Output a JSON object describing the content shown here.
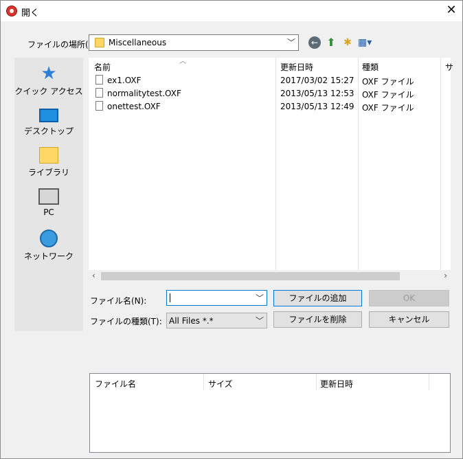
{
  "window": {
    "title": "開く",
    "close_symbol": "✕"
  },
  "lookin": {
    "label": "ファイルの場所(I):",
    "value": "Miscellaneous"
  },
  "places": [
    {
      "label": "クイック アクセス"
    },
    {
      "label": "デスクトップ"
    },
    {
      "label": "ライブラリ"
    },
    {
      "label": "PC"
    },
    {
      "label": "ネットワーク"
    }
  ],
  "filelist": {
    "columns": [
      "名前",
      "更新日時",
      "種類",
      "サ"
    ],
    "rows": [
      {
        "name": "ex1.OXF",
        "date": "2017/03/02 15:27",
        "type": "OXF ファイル"
      },
      {
        "name": "normalitytest.OXF",
        "date": "2013/05/13 12:53",
        "type": "OXF ファイル"
      },
      {
        "name": "onettest.OXF",
        "date": "2013/05/13 12:49",
        "type": "OXF ファイル"
      }
    ]
  },
  "form": {
    "filename_label": "ファイル名(N):",
    "filename_value": "",
    "filetype_label": "ファイルの種類(T):",
    "filetype_value": "All Files *.*"
  },
  "buttons": {
    "add": "ファイルの追加",
    "ok": "OK",
    "remove": "ファイルを削除",
    "cancel": "キャンセル"
  },
  "selected": {
    "columns": [
      "ファイル名",
      "サイズ",
      "更新日時"
    ]
  }
}
